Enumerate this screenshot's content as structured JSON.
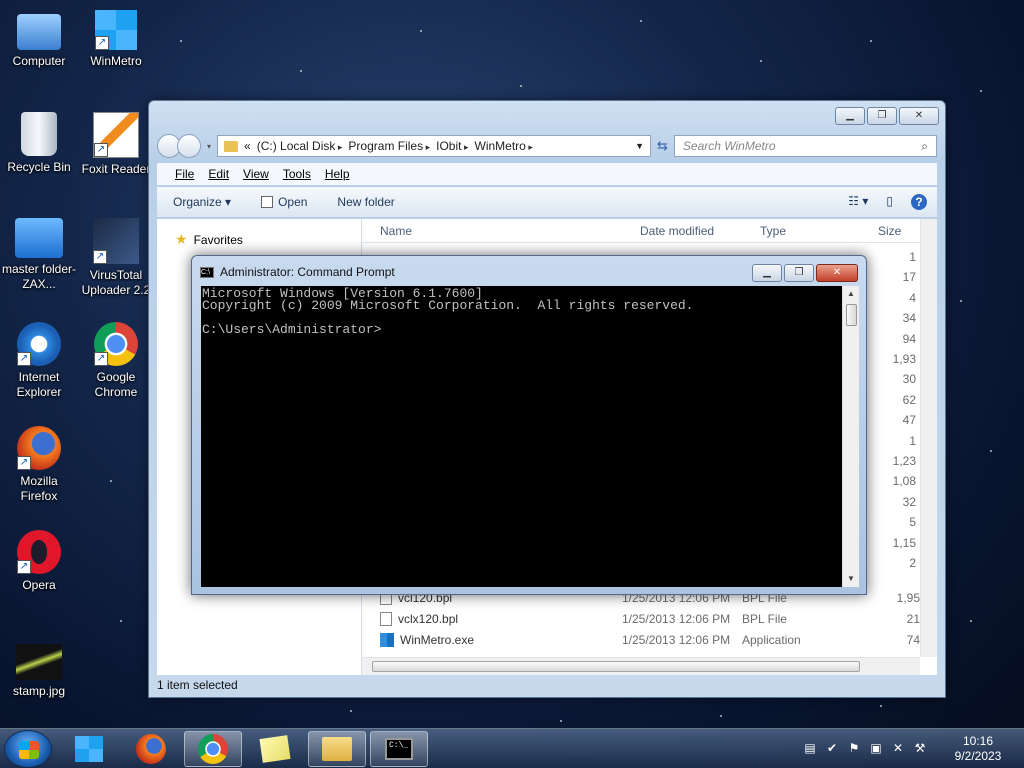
{
  "desktop": {
    "icons": [
      {
        "label": "Computer"
      },
      {
        "label": "WinMetro"
      },
      {
        "label": "Recycle Bin"
      },
      {
        "label": "Foxit Reader"
      },
      {
        "label": "master folder-ZAX..."
      },
      {
        "label": "VirusTotal Uploader 2.2"
      },
      {
        "label": "Internet Explorer"
      },
      {
        "label": "Google Chrome"
      },
      {
        "label": "Mozilla Firefox"
      },
      {
        "label": "Opera"
      },
      {
        "label": "stamp.jpg"
      }
    ]
  },
  "explorer": {
    "breadcrumb": [
      "(C:) Local Disk",
      "Program Files",
      "IObit",
      "WinMetro"
    ],
    "search_placeholder": "Search WinMetro",
    "menu": [
      "File",
      "Edit",
      "View",
      "Tools",
      "Help"
    ],
    "toolbar": {
      "organize": "Organize ▾",
      "open": "Open",
      "new_folder": "New folder"
    },
    "nav": {
      "favorites": "Favorites"
    },
    "columns": [
      "Name",
      "Date modified",
      "Type",
      "Size"
    ],
    "files": [
      {
        "name": "vcl120.bpl",
        "date": "1/25/2013 12:06 PM",
        "type": "BPL File",
        "size": "1,95"
      },
      {
        "name": "vclx120.bpl",
        "date": "1/25/2013 12:06 PM",
        "type": "BPL File",
        "size": "21"
      },
      {
        "name": "WinMetro.exe",
        "date": "1/25/2013 12:06 PM",
        "type": "Application",
        "size": "74"
      }
    ],
    "hidden_sizes": [
      "1",
      "17",
      "4",
      "34",
      "94",
      "1,93",
      "30",
      "62",
      "47",
      "1",
      "1,23",
      "1,08",
      "32",
      "5",
      "1,15",
      "2"
    ],
    "status": "1 item selected"
  },
  "cmd": {
    "title": "Administrator: Command Prompt",
    "lines": [
      "Microsoft Windows [Version 6.1.7600]",
      "Copyright (c) 2009 Microsoft Corporation.  All rights reserved.",
      "",
      "C:\\Users\\Administrator>"
    ]
  },
  "taskbar": {
    "time": "10:16",
    "date": "9/2/2023"
  }
}
